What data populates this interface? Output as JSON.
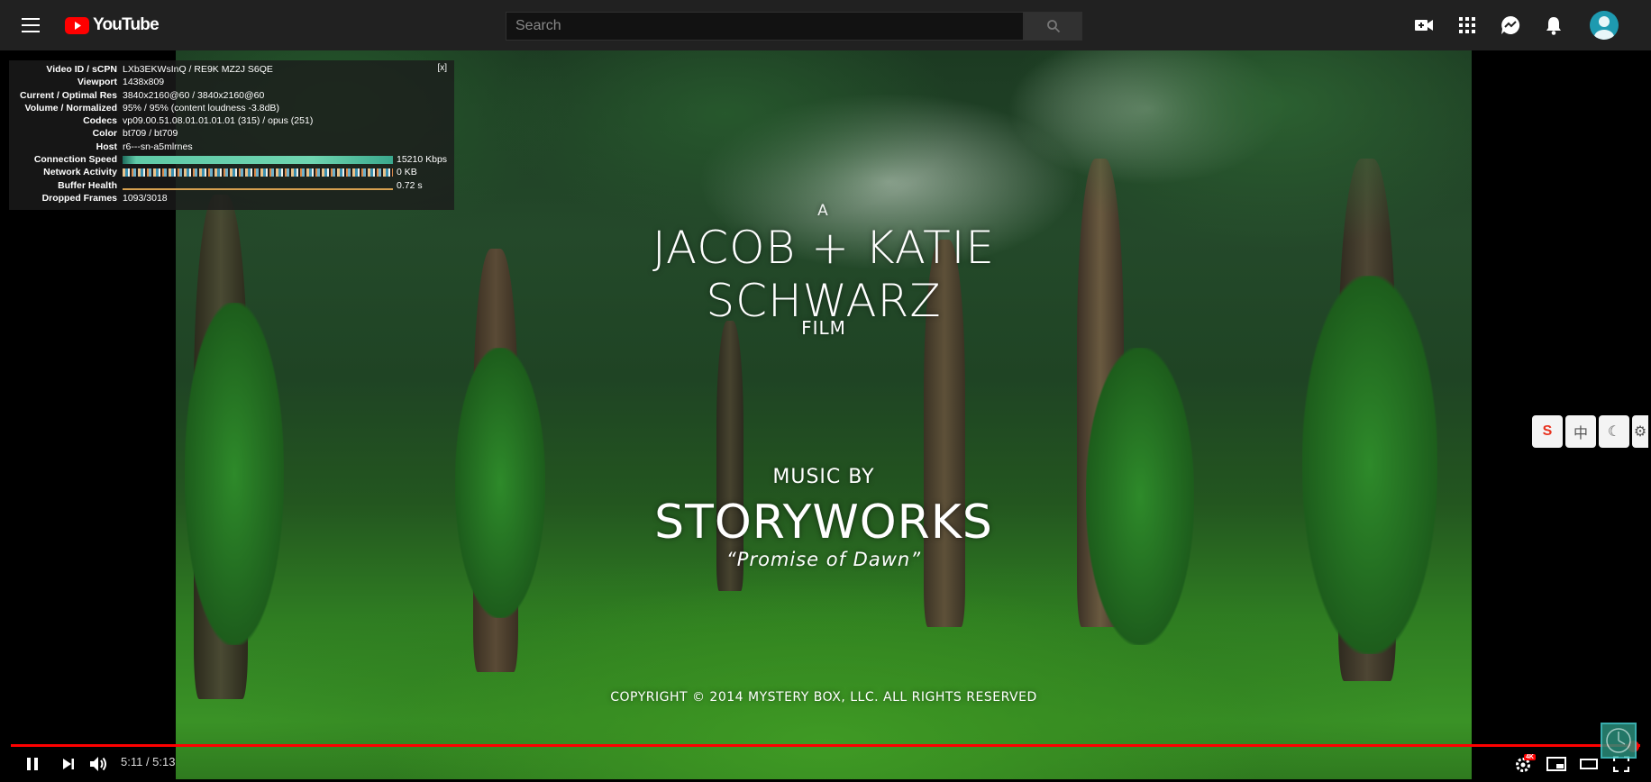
{
  "masthead": {
    "logo_text": "YouTube",
    "search_placeholder": "Search",
    "icons": [
      "menu-icon",
      "search-icon",
      "create-video-icon",
      "apps-icon",
      "messages-icon",
      "notifications-icon",
      "avatar"
    ]
  },
  "stats": {
    "close_label": "[x]",
    "rows": [
      {
        "label": "Video ID / sCPN",
        "value": "LXb3EKWsInQ / RE9K MZ2J S6QE"
      },
      {
        "label": "Viewport",
        "value": "1438x809"
      },
      {
        "label": "Current / Optimal Res",
        "value": "3840x2160@60 / 3840x2160@60"
      },
      {
        "label": "Volume / Normalized",
        "value": "95% / 95% (content loudness -3.8dB)"
      },
      {
        "label": "Codecs",
        "value": "vp09.00.51.08.01.01.01.01 (315) / opus (251)"
      },
      {
        "label": "Color",
        "value": "bt709 / bt709"
      },
      {
        "label": "Host",
        "value": "r6---sn-a5mlrnes"
      },
      {
        "label": "Connection Speed",
        "value": "15210 Kbps"
      },
      {
        "label": "Network Activity",
        "value": "0 KB"
      },
      {
        "label": "Buffer Health",
        "value": "0.72 s"
      },
      {
        "label": "Dropped Frames",
        "value": "1093/3018"
      }
    ]
  },
  "video": {
    "title_small": "A",
    "title_line1": "JACOB + KATIE",
    "title_line2": "SCHWARZ",
    "title_line3": "FILM",
    "music_by": "MUSIC BY",
    "composer": "STORYWORKS",
    "song": "“Promise of Dawn”",
    "copyright": "COPYRIGHT © 2014 MYSTERY BOX, LLC. ALL RIGHTS RESERVED"
  },
  "extensions": {
    "ext1": "S",
    "ext2": "中",
    "ext3": "☾",
    "ext4": "⚙"
  },
  "player": {
    "time": "5:11 / 5:13",
    "progress_fraction": 0.9935,
    "settings_badge": "4K",
    "accent_color": "#ff0000"
  }
}
